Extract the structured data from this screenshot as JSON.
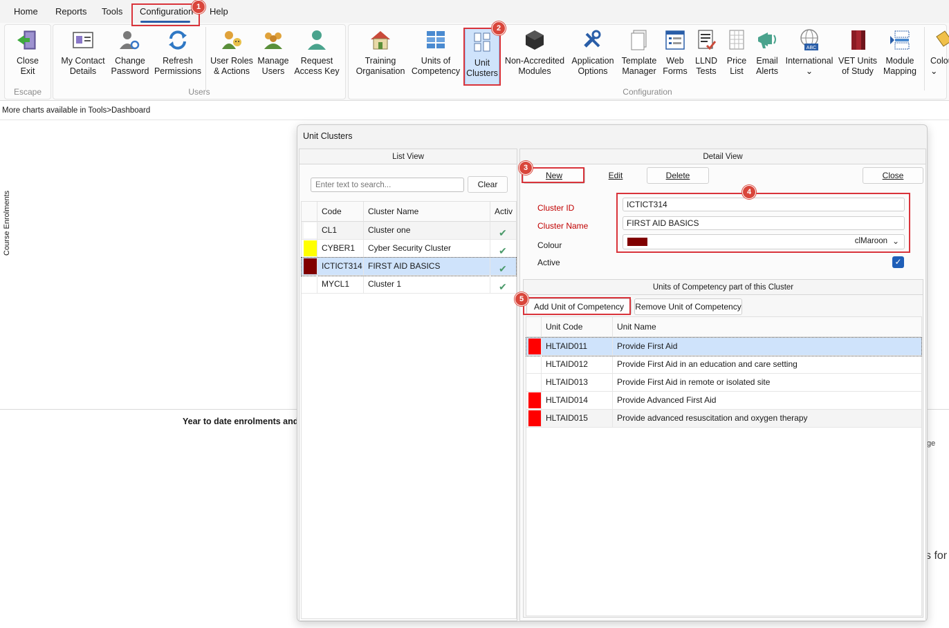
{
  "menu": {
    "items": [
      "Home",
      "Reports",
      "Tools",
      "Configuration",
      "Help"
    ],
    "active": "Configuration"
  },
  "ribbon": {
    "groups": {
      "escape": "Escape",
      "users": "Users",
      "configuration": "Configuration"
    },
    "buttons": {
      "close_exit": "Close\nExit",
      "my_contact": "My Contact\nDetails",
      "change_password": "Change\nPassword",
      "refresh_permissions": "Refresh\nPermissions",
      "user_roles": "User Roles\n& Actions",
      "manage_users": "Manage\nUsers",
      "request_key": "Request\nAccess Key",
      "training_org": "Training\nOrganisation",
      "units_competency": "Units of\nCompetency",
      "unit_clusters": "Unit\nClusters",
      "non_accredited": "Non-Accredited\nModules",
      "app_options": "Application\nOptions",
      "template_manager": "Template\nManager",
      "web_forms": "Web\nForms",
      "llnd_tests": "LLND\nTests",
      "price_list": "Price\nList",
      "email_alerts": "Email\nAlerts",
      "international": "International\n⌄",
      "vet_units": "VET Units\nof Study",
      "module_mapping": "Module\nMapping",
      "colour": "Colou\n⌄"
    }
  },
  "hint": "More charts available in Tools>Dashboard",
  "dashboard": {
    "vertical_label": "Course Enrolments",
    "ytd_title": "Year to date enrolments and",
    "right_fragment_1": "ge",
    "right_fragment_2": "s for"
  },
  "dialog": {
    "title": "Unit Clusters",
    "list_view": {
      "header": "List View",
      "search_placeholder": "Enter text to search...",
      "clear_label": "Clear",
      "columns": [
        "Code",
        "Cluster Name",
        "Activ"
      ],
      "rows": [
        {
          "code": "CL1",
          "name": "Cluster one",
          "active": true,
          "colour": "#ffffff"
        },
        {
          "code": "CYBER1",
          "name": "Cyber Security Cluster",
          "active": true,
          "colour": "#ffff00"
        },
        {
          "code": "ICTICT314",
          "name": "FIRST AID BASICS",
          "active": true,
          "colour": "#800000"
        },
        {
          "code": "MYCL1",
          "name": "Cluster 1",
          "active": true,
          "colour": "#ffffff"
        }
      ],
      "selected_index": 2
    },
    "detail_view": {
      "header": "Detail View",
      "buttons": {
        "new": "New",
        "edit": "Edit",
        "delete": "Delete",
        "close": "Close"
      },
      "fields": {
        "cluster_id_label": "Cluster ID",
        "cluster_id_value": "ICTICT314",
        "cluster_name_label": "Cluster Name",
        "cluster_name_value": "FIRST AID BASICS",
        "colour_label": "Colour",
        "colour_value": "clMaroon",
        "colour_hex": "#800000",
        "active_label": "Active",
        "active_checked": true
      },
      "units_section": {
        "header": "Units of Competency part of this Cluster",
        "add_label": "Add Unit of Competency",
        "remove_label": "Remove Unit of Competency",
        "columns": [
          "Unit Code",
          "Unit Name"
        ],
        "rows": [
          {
            "code": "HLTAID011",
            "name": "Provide First Aid",
            "colour": "#ff0000"
          },
          {
            "code": "HLTAID012",
            "name": "Provide First Aid in an education and care setting",
            "colour": "#ffffff"
          },
          {
            "code": "HLTAID013",
            "name": "Provide First Aid in remote or isolated site",
            "colour": "#ffffff"
          },
          {
            "code": "HLTAID014",
            "name": "Provide Advanced First Aid",
            "colour": "#ff0000"
          },
          {
            "code": "HLTAID015",
            "name": "Provide advanced resuscitation and oxygen therapy",
            "colour": "#ff0000"
          }
        ],
        "selected_index": 0
      }
    }
  },
  "annotations": [
    "1",
    "2",
    "3",
    "4",
    "5"
  ],
  "colors": {
    "accent": "#2a5ea8",
    "annotation": "#d9333a",
    "selection": "#cfe3fb"
  }
}
